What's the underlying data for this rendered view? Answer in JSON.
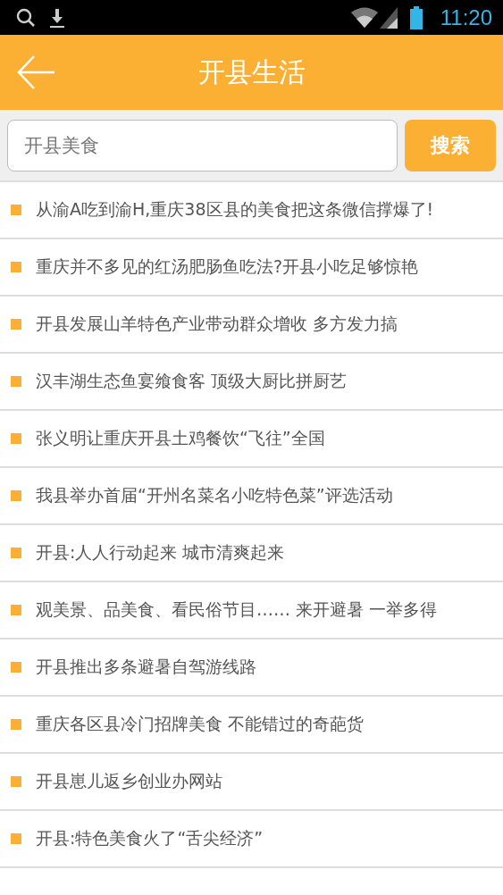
{
  "status_bar": {
    "time": "11:20"
  },
  "header": {
    "title": "开县生活"
  },
  "search": {
    "value": "开县美食",
    "button": "搜索"
  },
  "articles": [
    {
      "title": "从渝A吃到渝H,重庆38区县的美食把这条微信撑爆了!"
    },
    {
      "title": "重庆并不多见的红汤肥肠鱼吃法?开县小吃足够惊艳"
    },
    {
      "title": "开县发展山羊特色产业带动群众增收 多方发力搞"
    },
    {
      "title": "汉丰湖生态鱼宴飨食客 顶级大厨比拼厨艺"
    },
    {
      "title": "张义明让重庆开县土鸡餐饮“飞往”全国"
    },
    {
      "title": "我县举办首届“开州名菜名小吃特色菜”评选活动"
    },
    {
      "title": "开县:人人行动起来 城市清爽起来"
    },
    {
      "title": "观美景、品美食、看民俗节目…… 来开避暑 一举多得"
    },
    {
      "title": "开县推出多条避暑自驾游线路"
    },
    {
      "title": "重庆各区县冷门招牌美食 不能错过的奇葩货"
    },
    {
      "title": "开县崽儿返乡创业办网站"
    },
    {
      "title": "开县:特色美食火了“舌尖经济”"
    }
  ]
}
